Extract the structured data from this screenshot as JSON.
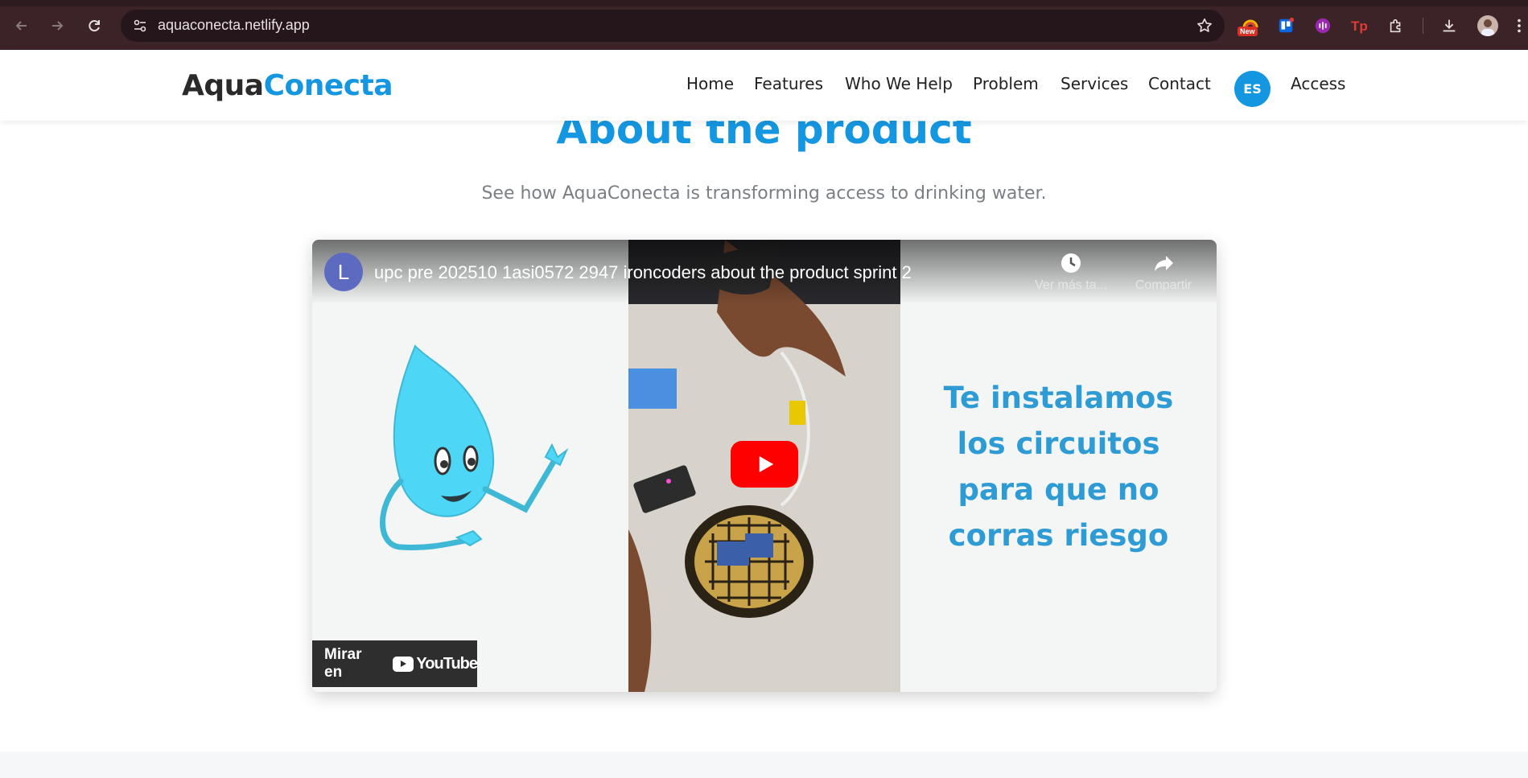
{
  "browser": {
    "url": "aquaconecta.netlify.app",
    "new_badge": "New"
  },
  "site": {
    "logo_part1": "Aqua",
    "logo_part2": "Conecta",
    "nav": {
      "home": "Home",
      "features": "Features",
      "who_we_help": "Who We Help",
      "problem": "Problem",
      "services": "Services",
      "contact": "Contact",
      "language": "ES",
      "access": "Access"
    }
  },
  "main": {
    "title": "About the product",
    "subtitle": "See how AquaConecta is transforming access to drinking water."
  },
  "video": {
    "channel_initial": "L",
    "title": "upc pre 202510 1asi0572 2947 ironcoders about the product sprint 2",
    "watch_later": "Ver más ta...",
    "share": "Compartir",
    "overlay_line1": "Te instalamos",
    "overlay_line2": "los circuitos",
    "overlay_line3": "para que no",
    "overlay_line4": "corras riesgo",
    "watch_on": "Mirar en",
    "youtube": "YouTube"
  },
  "colors": {
    "brand_blue": "#1596e0",
    "chrome_bg": "#3b2327",
    "youtube_red": "#ff0000"
  }
}
